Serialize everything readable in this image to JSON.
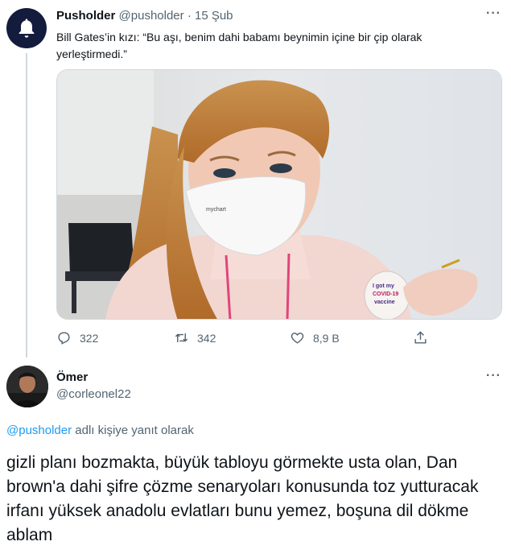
{
  "tweet": {
    "author_name": "Pusholder",
    "author_handle": "@pusholder",
    "separator": "·",
    "date": "15 Şub",
    "text": "Bill Gates’in kızı: “Bu aşı, benim dahi babamı beynimin içine bir çip olarak yerleştirmedi.”",
    "more_label": "···",
    "image": {
      "mask_text": "mychart",
      "sticker_lines": [
        "I got my",
        "COVID-19",
        "vaccine"
      ]
    },
    "replies": "322",
    "retweets": "342",
    "likes": "8,9 B"
  },
  "reply": {
    "author_name": "Ömer",
    "author_handle": "@corleonel22",
    "more_label": "···",
    "reply_to_mention": "@pusholder",
    "reply_to_suffix": " adlı kişiye yanıt olarak",
    "text": "gizli planı bozmakta, büyük tabloyu görmekte usta olan, Dan brown'a dahi şifre çözme senaryoları konusunda toz yutturacak irfanı yüksek anadolu evlatları bunu yemez, boşuna dil dökme ablam"
  },
  "colors": {
    "accent": "#1d9bf0",
    "secondary_text": "#536471",
    "avatar_bg": "#141c3d"
  }
}
